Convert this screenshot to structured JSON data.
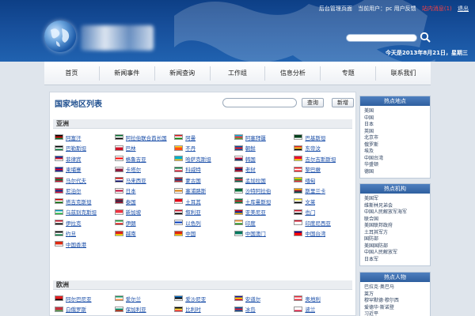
{
  "topbar": {
    "admin_link": "后台管理页面",
    "current_user_label": "当前用户：pc 用户反馈",
    "message": "站内消息(1)",
    "logout": "退出"
  },
  "header": {
    "date_text": "今天是2013年8月21日，星期三"
  },
  "nav": [
    "首页",
    "新闻事件",
    "新闻查询",
    "工作组",
    "信息分析",
    "专题",
    "联系我们"
  ],
  "main": {
    "title": "国家地区列表",
    "query_button": "查询",
    "add_button": "新增",
    "regions": [
      {
        "name": "亚洲",
        "countries": [
          {
            "name": "阿富汗",
            "colors": [
              "#000000",
              "#cc0000",
              "#007a36"
            ]
          },
          {
            "name": "阿拉伯联合酋长国",
            "colors": [
              "#00732f",
              "#ffffff",
              "#000000"
            ]
          },
          {
            "name": "阿曼",
            "colors": [
              "#db161b",
              "#ffffff",
              "#008000"
            ]
          },
          {
            "name": "阿塞拜疆",
            "colors": [
              "#00b5e2",
              "#ef3340",
              "#509e2f"
            ]
          },
          {
            "name": "巴基斯坦",
            "colors": [
              "#01411c",
              "#01411c",
              "#ffffff"
            ]
          },
          {
            "name": "巴勒斯坦",
            "colors": [
              "#000000",
              "#ffffff",
              "#007a3d"
            ]
          },
          {
            "name": "巴林",
            "colors": [
              "#ffffff",
              "#ce1126",
              "#ce1126"
            ]
          },
          {
            "name": "不丹",
            "colors": [
              "#ffd520",
              "#ff4e12",
              "#ff4e12"
            ]
          },
          {
            "name": "朝鲜",
            "colors": [
              "#024fa2",
              "#ed1c27",
              "#024fa2"
            ]
          },
          {
            "name": "东帝汶",
            "colors": [
              "#dc241f",
              "#ffc726",
              "#000000"
            ]
          },
          {
            "name": "菲律宾",
            "colors": [
              "#0038a8",
              "#ce1126",
              "#ffffff"
            ]
          },
          {
            "name": "格鲁吉亚",
            "colors": [
              "#ffffff",
              "#ff0000",
              "#ffffff"
            ]
          },
          {
            "name": "哈萨克斯坦",
            "colors": [
              "#00afca",
              "#00afca",
              "#fec50c"
            ]
          },
          {
            "name": "韩国",
            "colors": [
              "#ffffff",
              "#c60c30",
              "#003478"
            ]
          },
          {
            "name": "吉尔吉斯斯坦",
            "colors": [
              "#e8112d",
              "#e8112d",
              "#ffef00"
            ]
          },
          {
            "name": "柬埔寨",
            "colors": [
              "#032ea1",
              "#e00025",
              "#032ea1"
            ]
          },
          {
            "name": "卡塔尔",
            "colors": [
              "#ffffff",
              "#8d1b3d",
              "#8d1b3d"
            ]
          },
          {
            "name": "科威特",
            "colors": [
              "#007a3d",
              "#ffffff",
              "#ce1126"
            ]
          },
          {
            "name": "老挝",
            "colors": [
              "#ce1126",
              "#002868",
              "#ce1126"
            ]
          },
          {
            "name": "黎巴嫩",
            "colors": [
              "#ee161f",
              "#ffffff",
              "#ee161f"
            ]
          },
          {
            "name": "马尔代夫",
            "colors": [
              "#d21034",
              "#007e3a",
              "#d21034"
            ]
          },
          {
            "name": "马来西亚",
            "colors": [
              "#cc0001",
              "#ffffff",
              "#010066"
            ]
          },
          {
            "name": "蒙古国",
            "colors": [
              "#c4272f",
              "#015197",
              "#c4272f"
            ]
          },
          {
            "name": "孟加拉国",
            "colors": [
              "#006a4e",
              "#f42a41",
              "#006a4e"
            ]
          },
          {
            "name": "缅甸",
            "colors": [
              "#fecb00",
              "#34b233",
              "#ea2839"
            ]
          },
          {
            "name": "尼泊尔",
            "colors": [
              "#dc143c",
              "#003893",
              "#dc143c"
            ]
          },
          {
            "name": "日本",
            "colors": [
              "#ffffff",
              "#bc002d",
              "#ffffff"
            ]
          },
          {
            "name": "塞浦路斯",
            "colors": [
              "#ffffff",
              "#d57800",
              "#ffffff"
            ]
          },
          {
            "name": "沙特阿拉伯",
            "colors": [
              "#006c35",
              "#006c35",
              "#ffffff"
            ]
          },
          {
            "name": "斯里兰卡",
            "colors": [
              "#ffb700",
              "#8d153a",
              "#00534e"
            ]
          },
          {
            "name": "塔吉克斯坦",
            "colors": [
              "#cc0000",
              "#ffffff",
              "#006600"
            ]
          },
          {
            "name": "泰国",
            "colors": [
              "#a51931",
              "#2d2a4a",
              "#a51931"
            ]
          },
          {
            "name": "土耳其",
            "colors": [
              "#e30a17",
              "#e30a17",
              "#ffffff"
            ]
          },
          {
            "name": "土库曼斯坦",
            "colors": [
              "#00843d",
              "#d22630",
              "#00843d"
            ]
          },
          {
            "name": "文莱",
            "colors": [
              "#f7e017",
              "#ffffff",
              "#000000"
            ]
          },
          {
            "name": "乌兹别克斯坦",
            "colors": [
              "#0099b5",
              "#ffffff",
              "#1eb53a"
            ]
          },
          {
            "name": "新加坡",
            "colors": [
              "#ef3340",
              "#ef3340",
              "#ffffff"
            ]
          },
          {
            "name": "叙利亚",
            "colors": [
              "#ce1126",
              "#ffffff",
              "#000000"
            ]
          },
          {
            "name": "亚美尼亚",
            "colors": [
              "#d90012",
              "#0033a0",
              "#f2a800"
            ]
          },
          {
            "name": "也门",
            "colors": [
              "#ce1126",
              "#ffffff",
              "#000000"
            ]
          },
          {
            "name": "伊拉克",
            "colors": [
              "#ce1126",
              "#ffffff",
              "#000000"
            ]
          },
          {
            "name": "伊朗",
            "colors": [
              "#239f40",
              "#ffffff",
              "#da0000"
            ]
          },
          {
            "name": "以色列",
            "colors": [
              "#ffffff",
              "#0038b8",
              "#ffffff"
            ]
          },
          {
            "name": "印度",
            "colors": [
              "#ff9933",
              "#ffffff",
              "#138808"
            ]
          },
          {
            "name": "印度尼西亚",
            "colors": [
              "#ce1126",
              "#ffffff",
              "#ffffff"
            ]
          },
          {
            "name": "约旦",
            "colors": [
              "#000000",
              "#ffffff",
              "#007a3d"
            ]
          },
          {
            "name": "越南",
            "colors": [
              "#da251d",
              "#da251d",
              "#ffff00"
            ]
          },
          {
            "name": "中国",
            "colors": [
              "#de2910",
              "#de2910",
              "#ffde00"
            ]
          },
          {
            "name": "中国澳门",
            "colors": [
              "#00785e",
              "#00785e",
              "#ffffff"
            ]
          },
          {
            "name": "中国台湾",
            "colors": [
              "#000095",
              "#fe0000",
              "#fe0000"
            ]
          },
          {
            "name": "中国香港",
            "colors": [
              "#de2910",
              "#de2910",
              "#ffffff"
            ]
          }
        ]
      },
      {
        "name": "欧洲",
        "countries": [
          {
            "name": "阿尔巴尼亚",
            "colors": [
              "#e41e20",
              "#e41e20",
              "#000000"
            ]
          },
          {
            "name": "爱尔兰",
            "colors": [
              "#169b62",
              "#ffffff",
              "#ff883e"
            ]
          },
          {
            "name": "爱沙尼亚",
            "colors": [
              "#0072ce",
              "#000000",
              "#ffffff"
            ]
          },
          {
            "name": "安道尔",
            "colors": [
              "#10069f",
              "#fedd00",
              "#d50032"
            ]
          },
          {
            "name": "奥地利",
            "colors": [
              "#ed2939",
              "#ffffff",
              "#ed2939"
            ]
          },
          {
            "name": "白俄罗斯",
            "colors": [
              "#c8313e",
              "#c8313e",
              "#4aa657"
            ]
          },
          {
            "name": "保加利亚",
            "colors": [
              "#ffffff",
              "#00966e",
              "#d62612"
            ]
          },
          {
            "name": "比利时",
            "colors": [
              "#000000",
              "#fae042",
              "#ed2939"
            ]
          },
          {
            "name": "冰岛",
            "colors": [
              "#02529c",
              "#dc1e35",
              "#02529c"
            ]
          },
          {
            "name": "波兰",
            "colors": [
              "#ffffff",
              "#ffffff",
              "#dc143c"
            ]
          }
        ]
      }
    ]
  },
  "sidebar": [
    {
      "title": "热点地点",
      "items": [
        "美国",
        "中国",
        "日本",
        "英国",
        "北京市",
        "俄罗斯",
        "埃及",
        "中国台湾",
        "华盛顿",
        "德国"
      ]
    },
    {
      "title": "热点机构",
      "items": [
        "美国军",
        "维斯林兄弟会",
        "中国人民解放军海军",
        "联合国",
        "美国联邦政府",
        "土耳其军方",
        "国防部",
        "美国国防部",
        "中国人民解放军",
        "日本军"
      ]
    },
    {
      "title": "热点人物",
      "items": [
        "巴拉克·奥巴马",
        "莱万",
        "穆罕默德·穆尔西",
        "爱德华·斯诺登",
        "习近平"
      ]
    }
  ]
}
